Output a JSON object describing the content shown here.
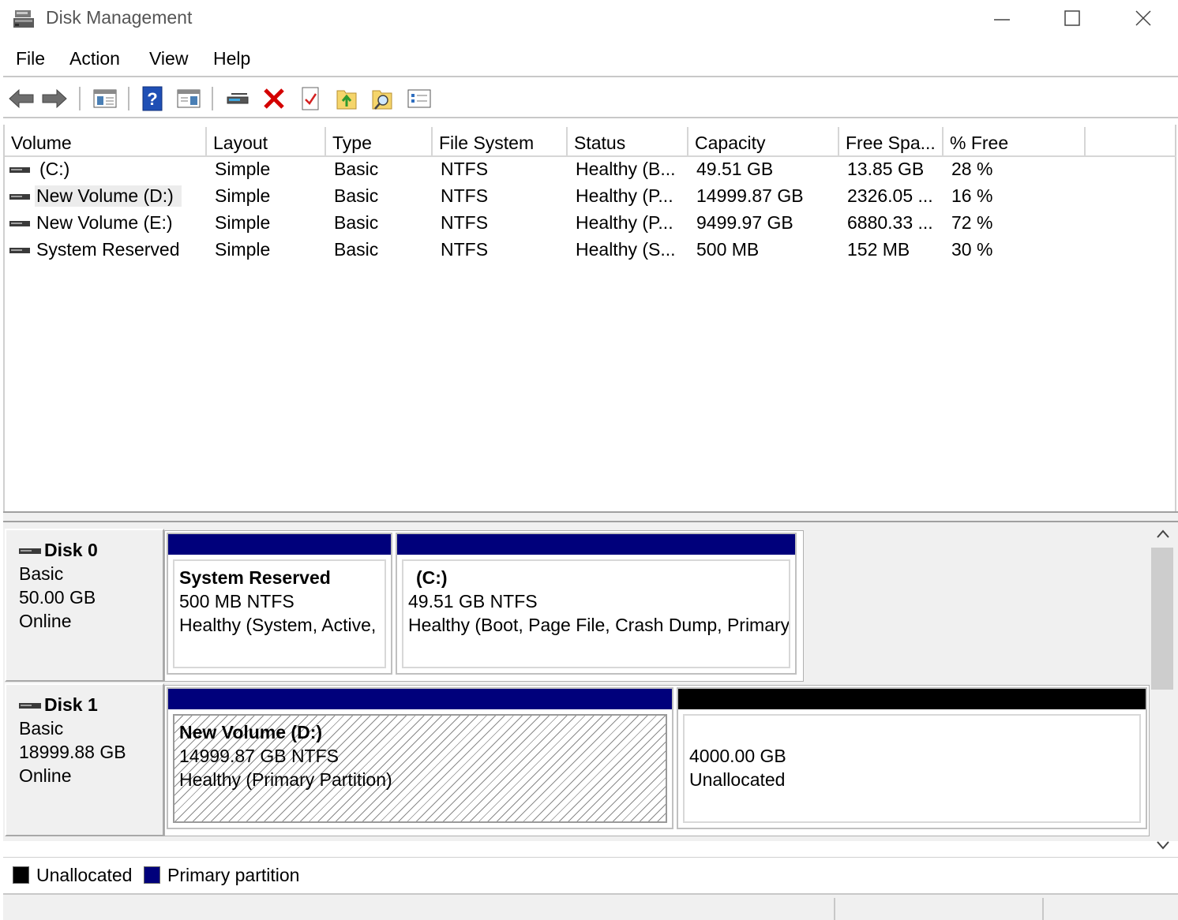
{
  "window": {
    "title": "Disk Management",
    "controls": {
      "minimize": "—",
      "maximize": "☐",
      "close": "✕"
    }
  },
  "menu": [
    "File",
    "Action",
    "View",
    "Help"
  ],
  "toolbar": [
    "back-icon",
    "forward-icon",
    "console-tree-icon",
    "help-icon",
    "details-pane-icon",
    "connect-drive-icon",
    "delete-icon",
    "properties-icon",
    "export-icon",
    "search-icon",
    "list-icon"
  ],
  "list": {
    "columns": [
      "Volume",
      "Layout",
      "Type",
      "File System",
      "Status",
      "Capacity",
      "Free Spa...",
      "% Free"
    ],
    "rows": [
      [
        "(C:)",
        "Simple",
        "Basic",
        "NTFS",
        "Healthy (B...",
        "49.51 GB",
        "13.85 GB",
        "28 %"
      ],
      [
        "New Volume (D:)",
        "Simple",
        "Basic",
        "NTFS",
        "Healthy (P...",
        "14999.87 GB",
        "2326.05 ...",
        "16 %"
      ],
      [
        "New Volume (E:)",
        "Simple",
        "Basic",
        "NTFS",
        "Healthy (P...",
        "9499.97 GB",
        "6880.33 ...",
        "72 %"
      ],
      [
        "System Reserved",
        "Simple",
        "Basic",
        "NTFS",
        "Healthy (S...",
        "500 MB",
        "152 MB",
        "30 %"
      ]
    ]
  },
  "disks": [
    {
      "name": "Disk 0",
      "type": "Basic",
      "size": "50.00 GB",
      "state": "Online",
      "partitions": [
        {
          "name": "System Reserved",
          "size": "500 MB NTFS",
          "status": "Healthy (System, Active,",
          "kind": "primary"
        },
        {
          "name": "(C:)",
          "size": "49.51 GB NTFS",
          "status": "Healthy (Boot, Page File, Crash Dump, Primary Partition)",
          "kind": "primary"
        }
      ]
    },
    {
      "name": "Disk 1",
      "type": "Basic",
      "size": "18999.88 GB",
      "state": "Online",
      "partitions": [
        {
          "name": "New Volume  (D:)",
          "size": "14999.87 GB NTFS",
          "status": "Healthy (Primary Partition)",
          "kind": "primary"
        },
        {
          "name": "",
          "size": "4000.00 GB",
          "status": "Unallocated",
          "kind": "unallocated"
        }
      ]
    }
  ],
  "legend": [
    {
      "label": "Unallocated",
      "color": "#000000"
    },
    {
      "label": "Primary partition",
      "color": "#00007b"
    }
  ],
  "colors": {
    "primary": "#00007b",
    "unallocated": "#000000",
    "chrome": "#f0f0f0"
  }
}
